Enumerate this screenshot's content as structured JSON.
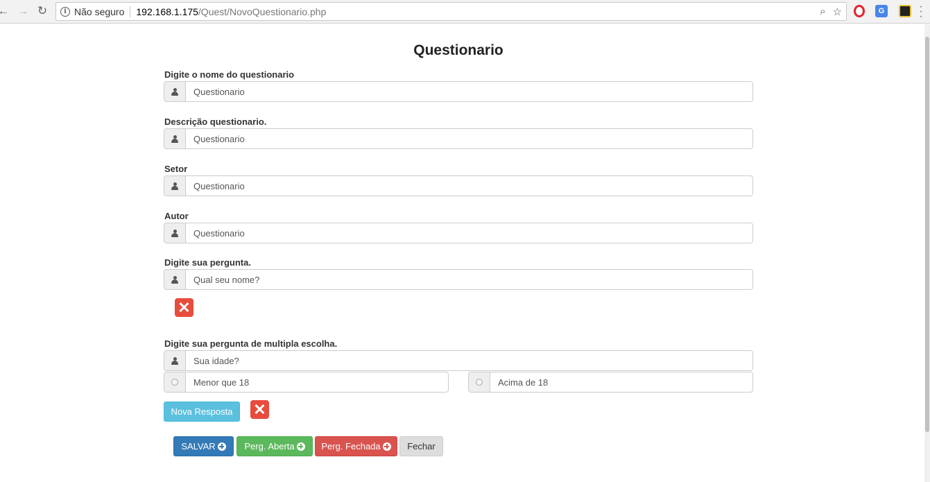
{
  "browser": {
    "security_label": "Não seguro",
    "url_host": "192.168.1.175",
    "url_path": "/Quest/NovoQuestionario.php"
  },
  "page": {
    "title": "Questionario",
    "fields": {
      "nome": {
        "label": "Digite o nome do questionario",
        "value": "Questionario"
      },
      "descricao": {
        "label": "Descrição questionario.",
        "value": "Questionario"
      },
      "setor": {
        "label": "Setor",
        "value": "Questionario"
      },
      "autor": {
        "label": "Autor",
        "value": "Questionario"
      },
      "pergunta": {
        "label": "Digite sua pergunta.",
        "value": "Qual seu nome?"
      },
      "multipla": {
        "label": "Digite sua pergunta de multipla escolha.",
        "value": "Sua idade?"
      }
    },
    "options": [
      {
        "value": "Menor que 18"
      },
      {
        "value": "Acima de 18"
      }
    ],
    "buttons": {
      "nova_resposta": "Nova Resposta",
      "salvar": "SALVAR",
      "perg_aberta": "Perg. Aberta",
      "perg_fechada": "Perg. Fechada",
      "fechar": "Fechar"
    }
  }
}
